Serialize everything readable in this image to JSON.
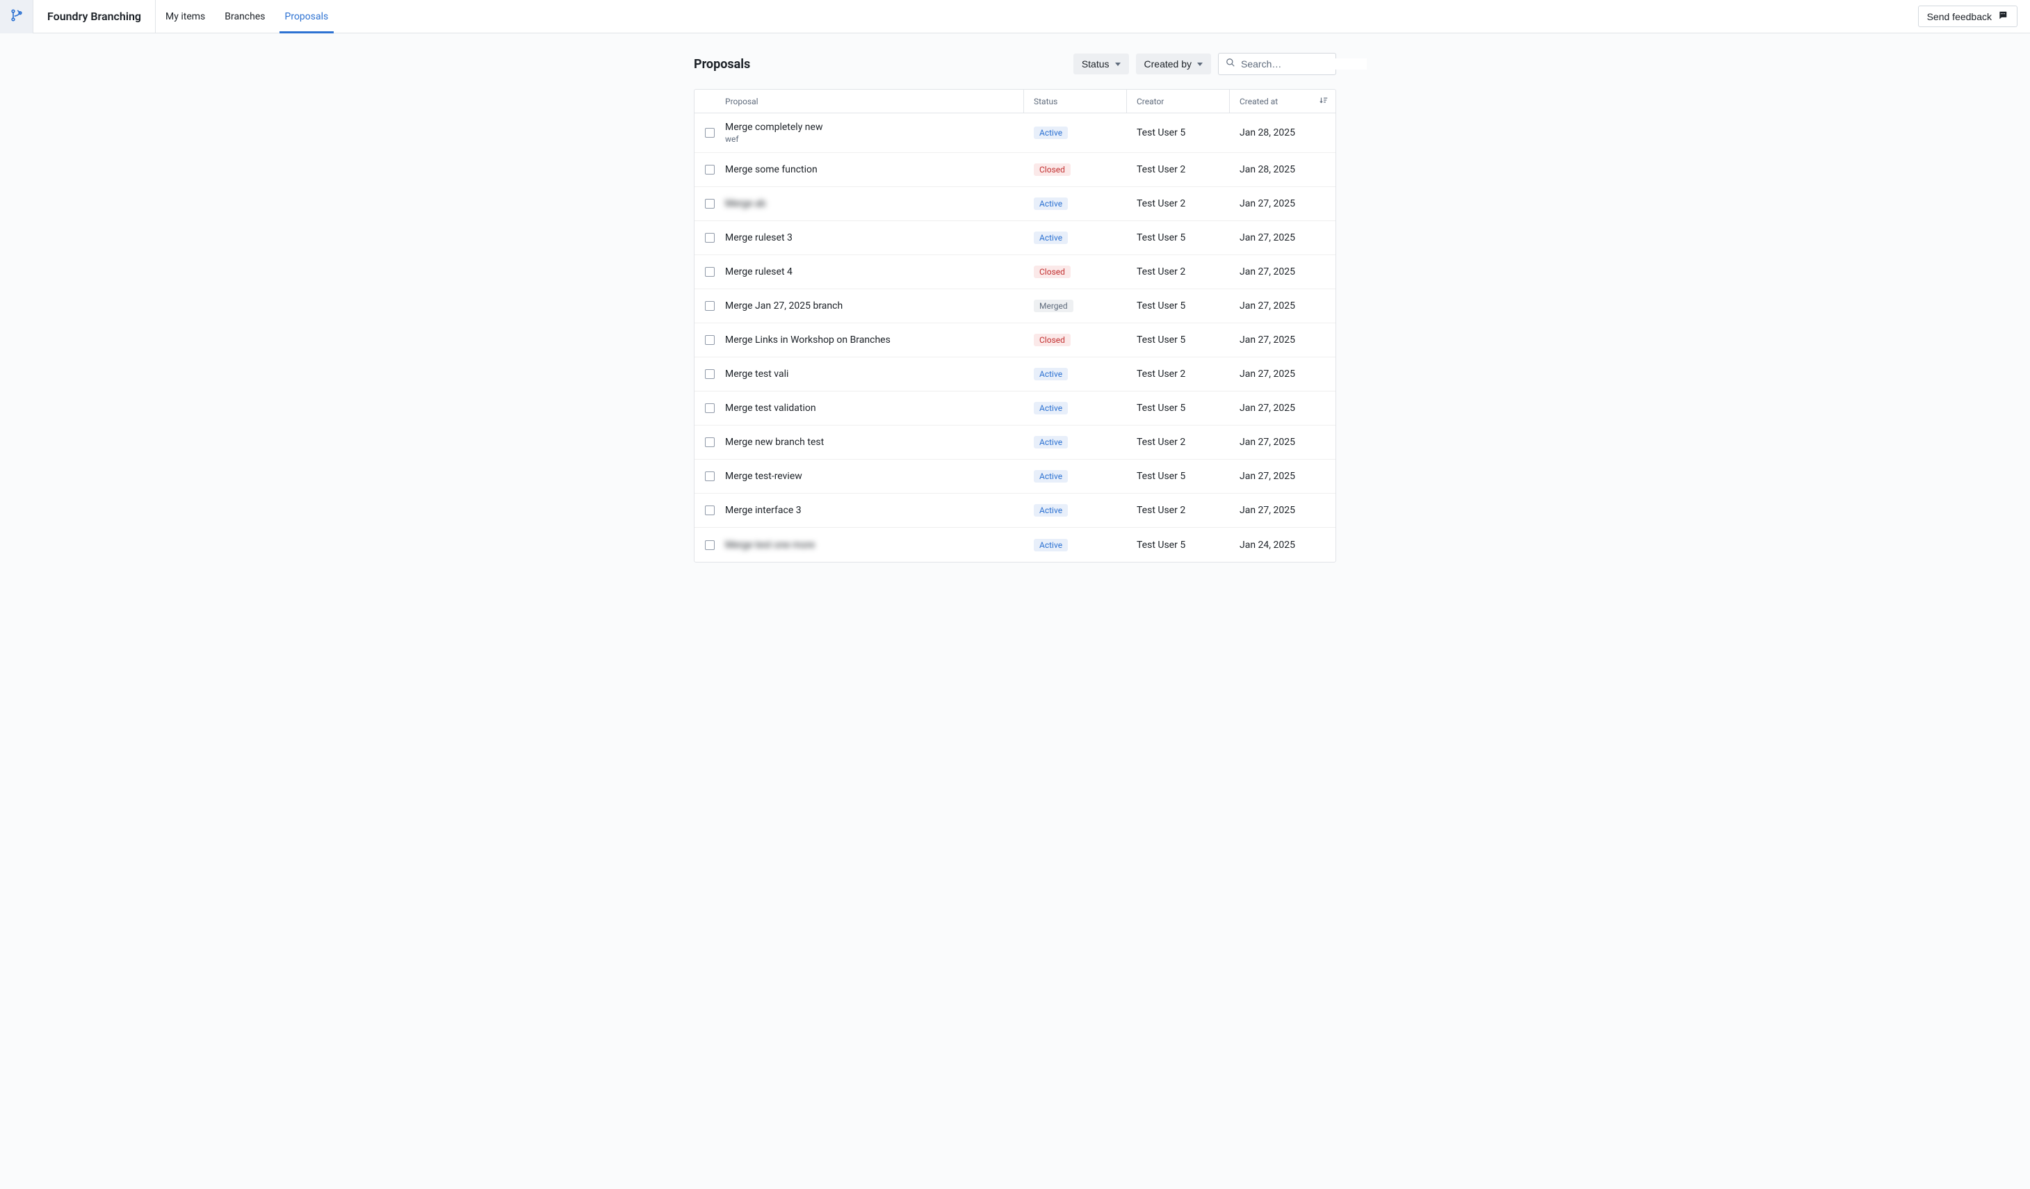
{
  "header": {
    "app_name": "Foundry Branching",
    "tabs": [
      {
        "label": "My items",
        "active": false
      },
      {
        "label": "Branches",
        "active": false
      },
      {
        "label": "Proposals",
        "active": true
      }
    ],
    "feedback_label": "Send feedback"
  },
  "page": {
    "title": "Proposals",
    "filters": {
      "status_label": "Status",
      "created_by_label": "Created by"
    },
    "search_placeholder": "Search…"
  },
  "columns": {
    "proposal": "Proposal",
    "status": "Status",
    "creator": "Creator",
    "created_at": "Created at"
  },
  "status_labels": {
    "active": "Active",
    "closed": "Closed",
    "merged": "Merged"
  },
  "rows": [
    {
      "title": "Merge completely new",
      "subtitle": "wef",
      "status": "active",
      "creator": "Test User 5",
      "created_at": "Jan 28, 2025",
      "blurred": false
    },
    {
      "title": "Merge some function",
      "subtitle": "",
      "status": "closed",
      "creator": "Test User 2",
      "created_at": "Jan 28, 2025",
      "blurred": false
    },
    {
      "title": "Merge ab",
      "subtitle": "",
      "status": "active",
      "creator": "Test User 2",
      "created_at": "Jan 27, 2025",
      "blurred": true
    },
    {
      "title": "Merge ruleset 3",
      "subtitle": "",
      "status": "active",
      "creator": "Test User 5",
      "created_at": "Jan 27, 2025",
      "blurred": false
    },
    {
      "title": "Merge ruleset 4",
      "subtitle": "",
      "status": "closed",
      "creator": "Test User 2",
      "created_at": "Jan 27, 2025",
      "blurred": false
    },
    {
      "title": "Merge Jan 27, 2025 branch",
      "subtitle": "",
      "status": "merged",
      "creator": "Test User 5",
      "created_at": "Jan 27, 2025",
      "blurred": false
    },
    {
      "title": "Merge  Links in Workshop on Branches",
      "subtitle": "",
      "status": "closed",
      "creator": "Test User 5",
      "created_at": "Jan 27, 2025",
      "blurred": false
    },
    {
      "title": "Merge test vali",
      "subtitle": "",
      "status": "active",
      "creator": "Test User 2",
      "created_at": "Jan 27, 2025",
      "blurred": false
    },
    {
      "title": "Merge test validation",
      "subtitle": "",
      "status": "active",
      "creator": "Test User 5",
      "created_at": "Jan 27, 2025",
      "blurred": false
    },
    {
      "title": "Merge new branch test",
      "subtitle": "",
      "status": "active",
      "creator": "Test User 2",
      "created_at": "Jan 27, 2025",
      "blurred": false
    },
    {
      "title": "Merge test-review",
      "subtitle": "",
      "status": "active",
      "creator": "Test User 5",
      "created_at": "Jan 27, 2025",
      "blurred": false
    },
    {
      "title": "Merge interface 3",
      "subtitle": "",
      "status": "active",
      "creator": "Test User 2",
      "created_at": "Jan 27, 2025",
      "blurred": false
    },
    {
      "title": "Merge test one more",
      "subtitle": "",
      "status": "active",
      "creator": "Test User 5",
      "created_at": "Jan 24, 2025",
      "blurred": true
    }
  ]
}
